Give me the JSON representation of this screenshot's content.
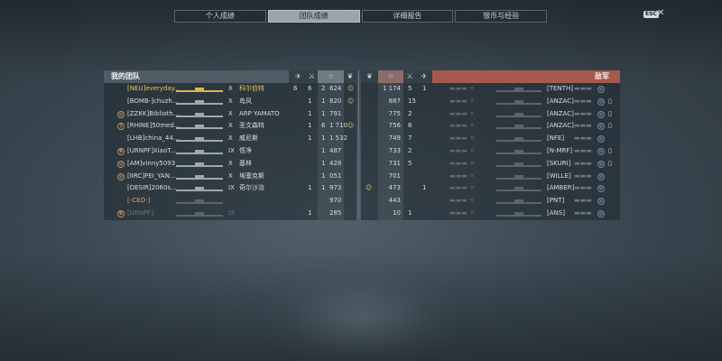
{
  "tabs": [
    {
      "label": "个人成绩",
      "active": false
    },
    {
      "label": "团队成绩",
      "active": true
    },
    {
      "label": "详细报告",
      "active": false
    },
    {
      "label": "银币与经验",
      "active": false
    }
  ],
  "esc_label": "ESC",
  "close_glyph": "✕",
  "my_team": {
    "title": "我的团队",
    "header_icons": [
      "plane-icon",
      "sword-icon",
      "star-icon",
      "laurel-icon"
    ],
    "rows": [
      {
        "badge": "",
        "clan": "[NEU]",
        "name": "everyday..",
        "tier": "X",
        "ship": "科尔伯特",
        "c1": "6",
        "c2": "6",
        "c3": "2",
        "xp": "624",
        "medal": "☺",
        "style": "gold"
      },
      {
        "badge": "",
        "clan": "[BOMB-]",
        "name": "chuzh...",
        "tier": "X",
        "ship": "岛风",
        "c1": "",
        "c2": "1",
        "c3": "1",
        "xp": "820",
        "medal": "☺",
        "style": "normal"
      },
      {
        "badge": "◎",
        "clan": "[ZZKK]",
        "name": "Biblioth...",
        "tier": "X",
        "ship": "ARP YAMATO",
        "c1": "",
        "c2": "1",
        "c3": "1",
        "xp": "791",
        "medal": "",
        "style": "normal"
      },
      {
        "badge": "3",
        "clan": "[RHINE]",
        "name": "50med...",
        "tier": "X",
        "ship": "圣文森特",
        "c1": "",
        "c2": "1",
        "c3": "6",
        "xp": "1 710",
        "medal": "☺",
        "style": "normal"
      },
      {
        "badge": "",
        "clan": "[LHB]",
        "name": "china_44...",
        "tier": "X",
        "ship": "威尼斯",
        "c1": "",
        "c2": "1",
        "c3": "1",
        "xp": "1 532",
        "medal": "",
        "style": "normal"
      },
      {
        "badge": "Ⅲ",
        "clan": "[URNPF]",
        "name": "XiaoT...",
        "tier": "IX",
        "ship": "悟净",
        "c1": "",
        "c2": "",
        "c3": "1",
        "xp": "487",
        "medal": "",
        "style": "normal"
      },
      {
        "badge": "◎",
        "clan": "[AM]",
        "name": "vinny5093",
        "tier": "X",
        "ship": "基林",
        "c1": "",
        "c2": "",
        "c3": "1",
        "xp": "428",
        "medal": "",
        "style": "normal"
      },
      {
        "badge": "◎",
        "clan": "[IIRC]",
        "name": "PEI_YAN...",
        "tier": "X",
        "ship": "埃塞克斯",
        "c1": "",
        "c2": "",
        "c3": "1",
        "xp": "051",
        "medal": "",
        "style": "normal"
      },
      {
        "badge": "",
        "clan": "[DESIR]",
        "name": "2060s...",
        "tier": "IX",
        "ship": "奇尔沙治",
        "c1": "",
        "c2": "1",
        "c3": "1",
        "xp": "973",
        "medal": "",
        "style": "normal"
      },
      {
        "badge": "",
        "clan": "[-CEO-]",
        "name": "",
        "tier": "",
        "ship": "",
        "c1": "",
        "c2": "",
        "c3": "",
        "xp": "970",
        "medal": "",
        "style": "dead-orange"
      },
      {
        "badge": "Ⅲ",
        "clan": "[URNPF]",
        "name": "",
        "tier": "IX",
        "ship": "",
        "c1": "",
        "c2": "1",
        "c3": "",
        "xp": "285",
        "medal": "",
        "style": "dead"
      }
    ]
  },
  "enemy_team": {
    "title": "敌军",
    "header_icons": [
      "laurel-icon",
      "star-icon",
      "sword-icon",
      "plane-icon"
    ],
    "rows": [
      {
        "medal": "",
        "xp": "1 174",
        "c1": "5",
        "c2": "1",
        "clan": "[TENTH]"
      },
      {
        "medal": "",
        "xp": "887",
        "c1": "15",
        "c2": "",
        "clan": "[ANZAC]"
      },
      {
        "medal": "",
        "xp": "775",
        "c1": "2",
        "c2": "",
        "clan": "[ANZAC]"
      },
      {
        "medal": "",
        "xp": "756",
        "c1": "6",
        "c2": "",
        "clan": "[ANZAC]"
      },
      {
        "medal": "",
        "xp": "749",
        "c1": "7",
        "c2": "",
        "clan": "[NFE]"
      },
      {
        "medal": "",
        "xp": "733",
        "c1": "2",
        "c2": "",
        "clan": "[N-MRF]"
      },
      {
        "medal": "",
        "xp": "731",
        "c1": "5",
        "c2": "",
        "clan": "[SKURI]"
      },
      {
        "medal": "",
        "xp": "701",
        "c1": "",
        "c2": "",
        "clan": "[WILLE]"
      },
      {
        "medal": "☺",
        "xp": "473",
        "c1": "",
        "c2": "1",
        "clan": "[AMBER]"
      },
      {
        "medal": "",
        "xp": "443",
        "c1": "",
        "c2": "",
        "clan": "[PNT]"
      },
      {
        "medal": "",
        "xp": "10",
        "c1": "1",
        "c2": "",
        "clan": "[ANS]"
      }
    ]
  },
  "colors": {
    "ally_header": "#4f5c63",
    "enemy_header": "#a65a4e",
    "gold_player": "#e3c65a",
    "orange_clan": "#e4a360"
  }
}
